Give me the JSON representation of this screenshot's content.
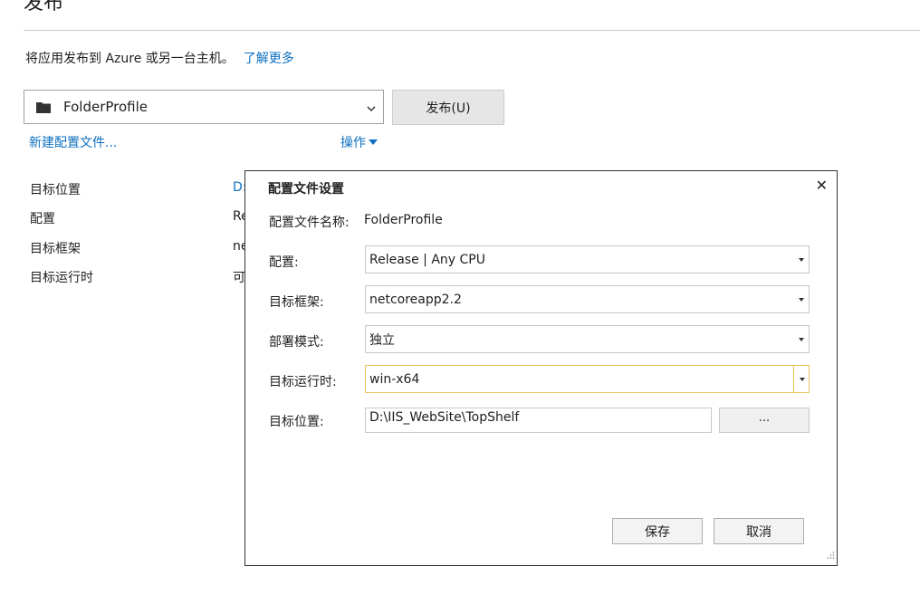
{
  "page": {
    "title": "发布",
    "subtitle": "将应用发布到 Azure 或另一台主机。",
    "learn_more": "了解更多"
  },
  "profile_selector": {
    "icon": "folder-icon",
    "selected": "FolderProfile"
  },
  "publish_button": "发布(U)",
  "new_profile_link": "新建配置文件...",
  "actions_menu": "操作",
  "summary": [
    {
      "label": "目标位置",
      "value": "D:"
    },
    {
      "label": "配置",
      "value": "Re"
    },
    {
      "label": "目标框架",
      "value": "ne"
    },
    {
      "label": "目标运行时",
      "value": "可"
    }
  ],
  "dialog": {
    "title": "配置文件设置",
    "close": "✕",
    "profile_name_label": "配置文件名称:",
    "profile_name_value": "FolderProfile",
    "configuration_label": "配置:",
    "configuration_value": "Release | Any CPU",
    "framework_label": "目标框架:",
    "framework_value": "netcoreapp2.2",
    "deployment_label": "部署模式:",
    "deployment_value": "独立",
    "runtime_label": "目标运行时:",
    "runtime_value": "win-x64",
    "location_label": "目标位置:",
    "location_value": "D:\\IIS_WebSite\\TopShelf",
    "browse": "...",
    "save": "保存",
    "cancel": "取消"
  },
  "colors": {
    "link": "#0e70c0",
    "focus_border": "#e8c25c",
    "button_bg": "#e6e6e6"
  }
}
